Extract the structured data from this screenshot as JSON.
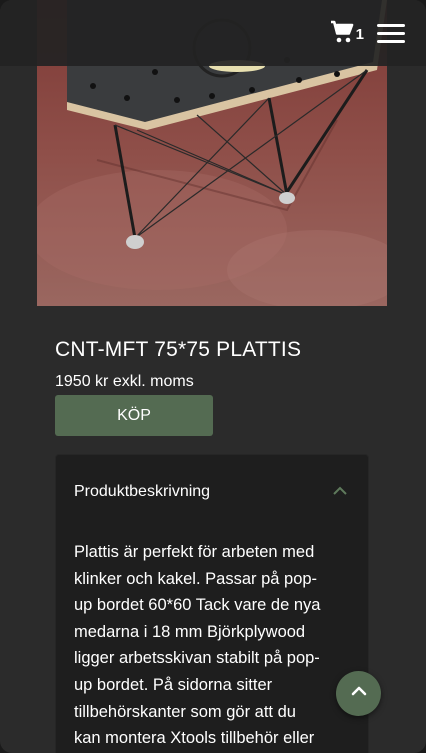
{
  "header": {
    "cart_count": "1",
    "icons": {
      "cart": "cart-icon",
      "menu": "hamburger-menu-icon"
    }
  },
  "product": {
    "title": "CNT-MFT 75*75 PLATTIS",
    "price": "1950 kr exkl. moms",
    "buy_label": "KÖP",
    "accent_color": "#546b52"
  },
  "description": {
    "heading": "Produktbeskrivning",
    "lines": [
      "Plattis är perfekt för arbeten med",
      "klinker och kakel. Passar på pop-",
      "up bordet 60*60 Tack vare de nya",
      "medarna i 18 mm Björkplywood",
      "ligger arbetsskivan stabilt på pop-",
      "up bordet. På sidorna sitter",
      "tillbehörskanter som gör att du",
      "kan montera Xtools tillbehör eller"
    ]
  },
  "scroll_top": {
    "icon": "chevron-up-icon"
  }
}
